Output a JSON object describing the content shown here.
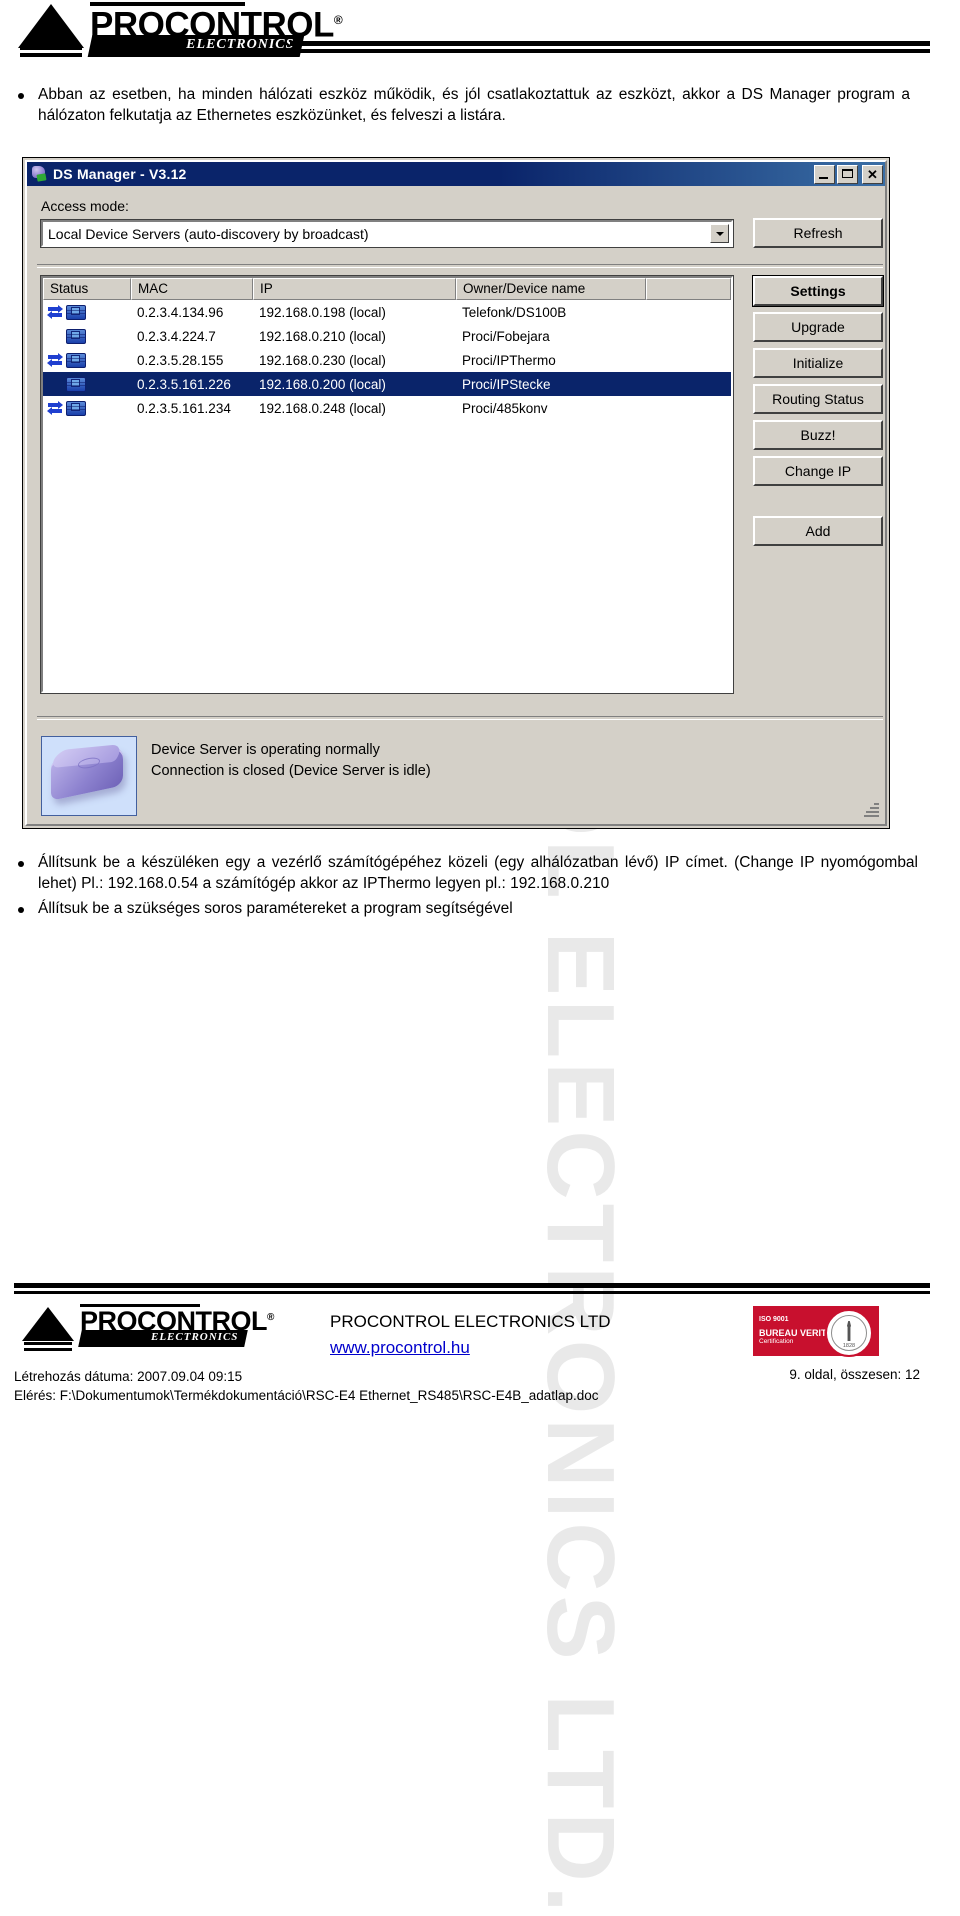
{
  "document": {
    "brand": "PROCONTROL",
    "brand_sub": "ELECTRONICS",
    "brand_registered": "®"
  },
  "watermark": {
    "text": "PROCONTROL ELECTRONICS LTD."
  },
  "intro_bullets": [
    "Abban az esetben, ha minden hálózati eszköz működik, és jól csatlakoztattuk az eszközt, akkor a DS Manager program a hálózaton felkutatja az Ethernetes eszközünket, és felveszi a listára."
  ],
  "after_bullets": [
    "Állítsunk be a készüléken egy a vezérlő számítógépéhez közeli (egy alhálózatban lévő) IP címet. (Change IP nyomógombal lehet) Pl.: 192.168.0.54 a számítógép akkor az IPThermo legyen pl.: 192.168.0.210",
    "Állítsuk be a szükséges soros paramétereket a program segítségével"
  ],
  "window": {
    "title": "DS Manager - V3.12",
    "icon": "ds-manager-icon",
    "minimize_label": "_",
    "maximize_label": "□",
    "close_label": "✕",
    "access_mode_label": "Access mode:",
    "access_mode_value": "Local Device Servers (auto-discovery by broadcast)",
    "refresh_label": "Refresh",
    "columns": [
      "Status",
      "MAC",
      "IP",
      "Owner/Device name",
      ""
    ],
    "rows": [
      {
        "traffic": true,
        "mac": "0.2.3.4.134.96",
        "ip": "192.168.0.198 (local)",
        "name": "Telefonk/DS100B",
        "selected": false
      },
      {
        "traffic": false,
        "mac": "0.2.3.4.224.7",
        "ip": "192.168.0.210 (local)",
        "name": "Proci/Fobejara",
        "selected": false
      },
      {
        "traffic": true,
        "mac": "0.2.3.5.28.155",
        "ip": "192.168.0.230 (local)",
        "name": "Proci/IPThermo",
        "selected": false
      },
      {
        "traffic": false,
        "mac": "0.2.3.5.161.226",
        "ip": "192.168.0.200 (local)",
        "name": "Proci/IPStecke",
        "selected": true
      },
      {
        "traffic": true,
        "mac": "0.2.3.5.161.234",
        "ip": "192.168.0.248 (local)",
        "name": "Proci/485konv",
        "selected": false
      }
    ],
    "action_buttons": [
      {
        "label": "Settings",
        "default": true
      },
      {
        "label": "Upgrade",
        "default": false
      },
      {
        "label": "Initialize",
        "default": false
      },
      {
        "label": "Routing Status",
        "default": false
      },
      {
        "label": "Buzz!",
        "default": false
      },
      {
        "label": "Change IP",
        "default": false
      }
    ],
    "add_button": "Add",
    "status_line1": "Device Server is operating normally",
    "status_line2": "Connection is closed (Device Server is idle)",
    "status_icon": "device-server-icon",
    "title_gradient_start": "#0a246a",
    "face_color": "#d4d0c8",
    "selection_color": "#0a246a"
  },
  "footer": {
    "company": "PROCONTROL ELECTRONICS LTD",
    "website": "www.procontrol.hu",
    "iso_standard": "ISO 9001",
    "iso_body": "BUREAU VERITAS",
    "iso_sub": "Certification",
    "iso_seal_text": "BUREAU VERITAS",
    "iso_seal_year": "1828",
    "created": "Létrehozás dátuma: 2007.09.04 09:15",
    "path": "Elérés: F:\\Dokumentumok\\Termékdokumentáció\\RSC-E4 Ethernet_RS485\\RSC-E4B_adatlap.doc",
    "page": "9. oldal, összesen: 12"
  }
}
